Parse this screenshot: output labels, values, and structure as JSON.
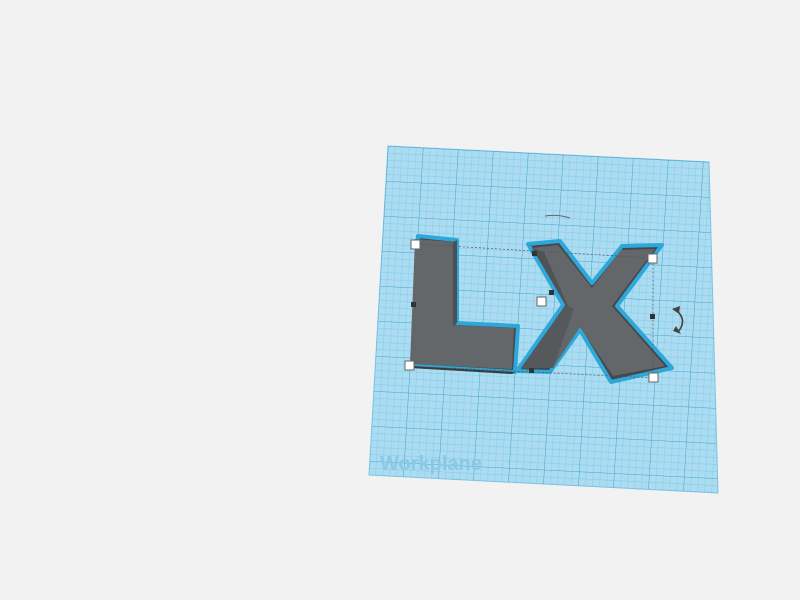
{
  "workplane": {
    "label": "Workplane",
    "fill_color": "#a9dcf0",
    "grid_color": "#5fb5da",
    "label_color": "#8cc8e4"
  },
  "shapes": [
    {
      "name": "L",
      "type": "letter",
      "color": "#5f6366"
    },
    {
      "name": "X",
      "type": "letter",
      "color": "#5f6366"
    }
  ],
  "selection": {
    "outline_color": "#2ea8da",
    "handle_color": "#ffffff",
    "rotate_icon": "rotate-arrow-icon"
  }
}
